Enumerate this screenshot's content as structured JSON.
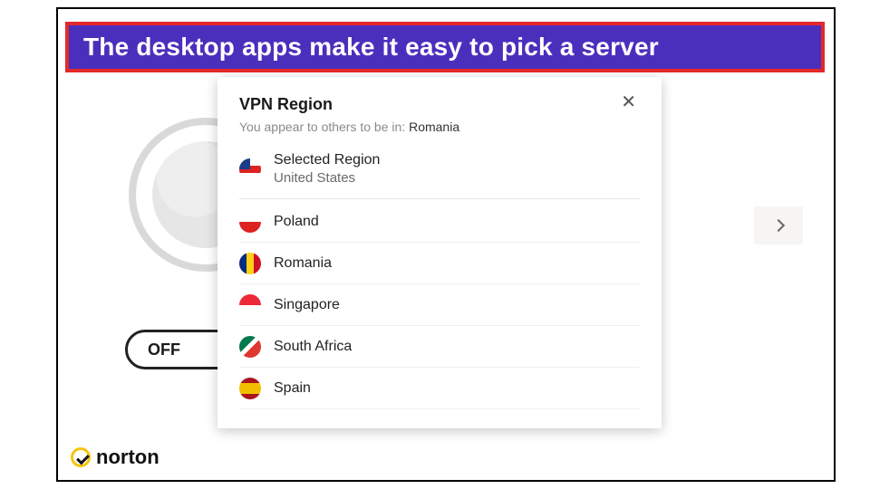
{
  "caption": "The desktop apps make it easy to pick a server",
  "app": {
    "toggle_label": "OFF",
    "brand": "norton"
  },
  "dialog": {
    "title": "VPN Region",
    "subtext_prefix": "You appear to others to be in:",
    "subtext_location": "Romania",
    "selected_heading": "Selected Region",
    "selected_country": "United States",
    "regions": [
      {
        "name": "Poland",
        "flag": "pl"
      },
      {
        "name": "Romania",
        "flag": "ro"
      },
      {
        "name": "Singapore",
        "flag": "sg"
      },
      {
        "name": "South Africa",
        "flag": "za"
      },
      {
        "name": "Spain",
        "flag": "es"
      }
    ]
  }
}
